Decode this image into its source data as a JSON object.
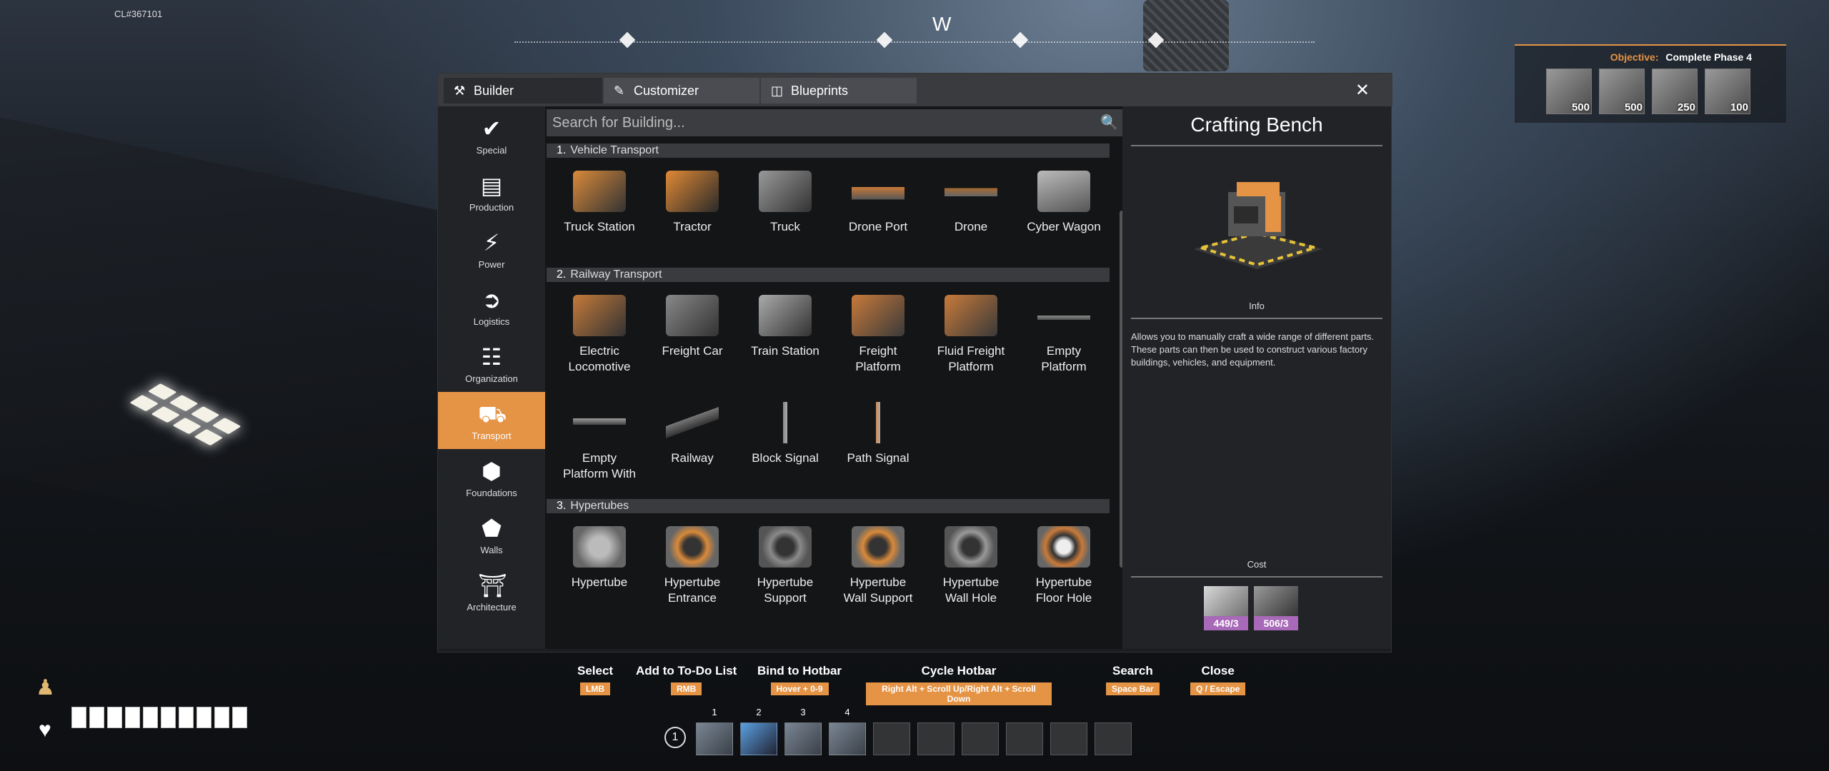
{
  "hud": {
    "building_id": "CL#367101",
    "compass_heading": "W"
  },
  "objective": {
    "label": "Objective:",
    "text": "Complete Phase 4",
    "items": [
      {
        "count": "500"
      },
      {
        "count": "500"
      },
      {
        "count": "250"
      },
      {
        "count": "100"
      }
    ]
  },
  "tabs": [
    {
      "label": "Builder",
      "icon": "hammer-icon"
    },
    {
      "label": "Customizer",
      "icon": "brush-icon"
    },
    {
      "label": "Blueprints",
      "icon": "blueprint-icon"
    }
  ],
  "close_label": "✕",
  "categories": [
    {
      "label": "Special",
      "icon": "check-icon"
    },
    {
      "label": "Production",
      "icon": "factory-icon"
    },
    {
      "label": "Power",
      "icon": "lightning-icon"
    },
    {
      "label": "Logistics",
      "icon": "logistics-icon"
    },
    {
      "label": "Organization",
      "icon": "org-chart-icon"
    },
    {
      "label": "Transport",
      "icon": "truck-icon"
    },
    {
      "label": "Foundations",
      "icon": "foundation-icon"
    },
    {
      "label": "Walls",
      "icon": "wall-icon"
    },
    {
      "label": "Architecture",
      "icon": "architecture-icon"
    }
  ],
  "active_category": "Transport",
  "search": {
    "placeholder": "Search for Building...",
    "value": ""
  },
  "sections": [
    {
      "num": "1.",
      "title": "Vehicle Transport",
      "items": [
        "Truck Station",
        "Tractor",
        "Truck",
        "Drone Port",
        "Drone",
        "Cyber Wagon"
      ]
    },
    {
      "num": "2.",
      "title": "Railway Transport",
      "items": [
        "Electric\nLocomotive",
        "Freight Car",
        "Train Station",
        "Freight\nPlatform",
        "Fluid Freight\nPlatform",
        "Empty\nPlatform",
        "Empty\nPlatform With",
        "Railway",
        "Block Signal",
        "Path Signal"
      ]
    },
    {
      "num": "3.",
      "title": "Hypertubes",
      "items": [
        "Hypertube",
        "Hypertube\nEntrance",
        "Hypertube\nSupport",
        "Hypertube\nWall Support",
        "Hypertube\nWall Hole",
        "Hypertube\nFloor Hole"
      ]
    }
  ],
  "details": {
    "title": "Crafting Bench",
    "info_label": "Info",
    "description": "Allows you to manually craft a wide range of different parts. These parts can then be used to construct various factory buildings, vehicles, and equipment.",
    "cost_label": "Cost",
    "cost": [
      {
        "qty": "449/3"
      },
      {
        "qty": "506/3"
      }
    ]
  },
  "hints": [
    {
      "label": "Select",
      "key": "LMB"
    },
    {
      "label": "Add to To-Do List",
      "key": "RMB"
    },
    {
      "label": "Bind to Hotbar",
      "key": "Hover + 0-9"
    },
    {
      "label": "Cycle Hotbar",
      "key": "Right Alt + Scroll Up/Right Alt + Scroll Down"
    },
    {
      "label": "Search",
      "key": "Space Bar"
    },
    {
      "label": "Close",
      "key": "Q / Escape"
    }
  ],
  "hotbar": {
    "page": "1",
    "slot_numbers": [
      "1",
      "2",
      "3",
      "4"
    ]
  },
  "colors": {
    "accent": "#e59345",
    "cost_badge": "#a869b8"
  }
}
